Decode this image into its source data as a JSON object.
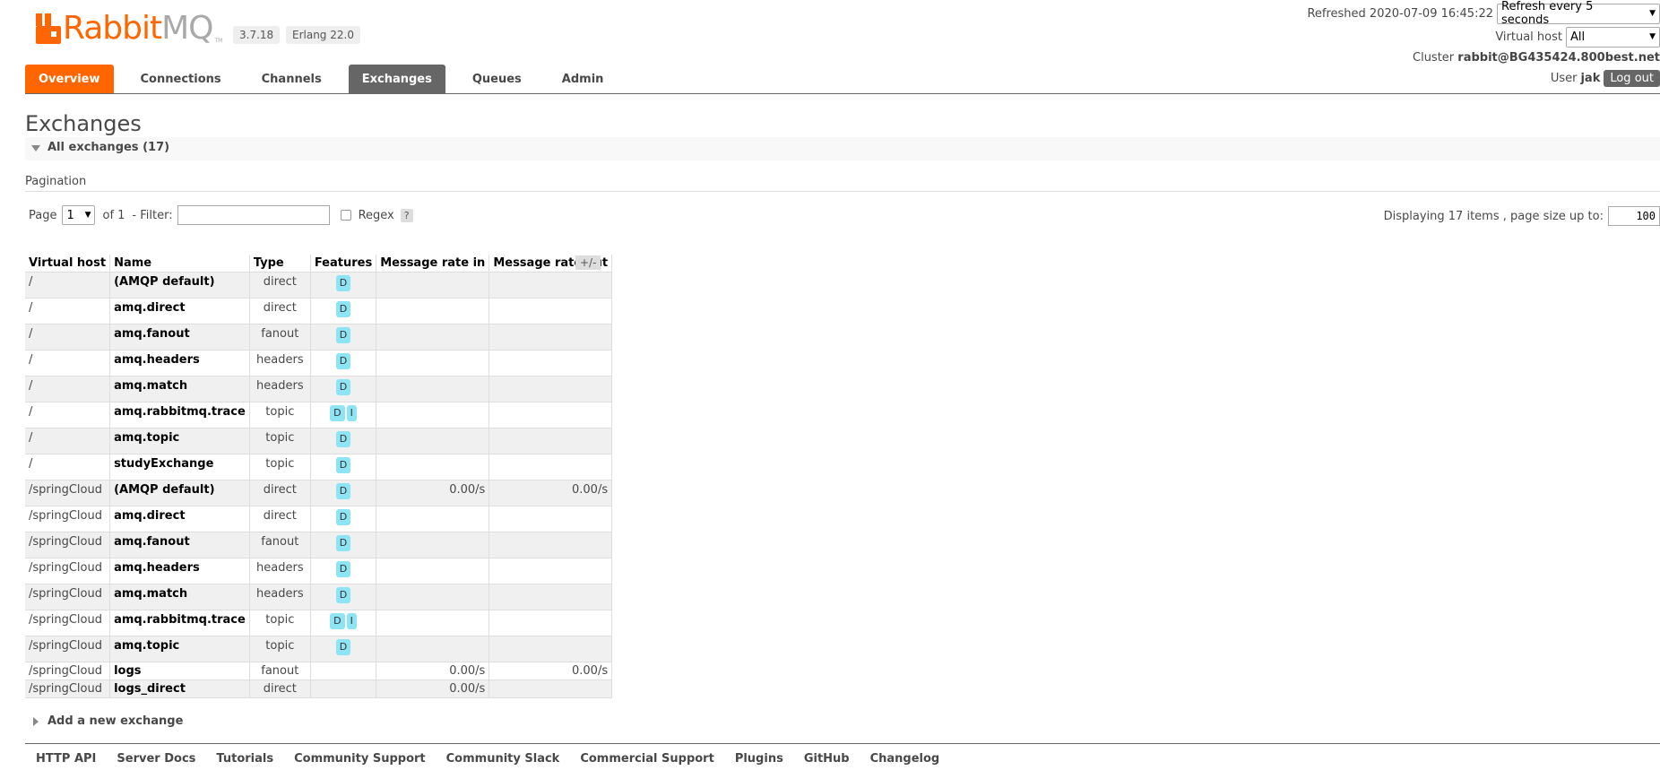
{
  "brand": {
    "word1": "Rabbit",
    "word2": "MQ",
    "tm": "TM",
    "version": "3.7.18",
    "erlang": "Erlang 22.0",
    "brand_color": "#ff6600"
  },
  "header": {
    "refreshed_label": "Refreshed 2020-07-09 16:45:22",
    "refresh_option": "Refresh every 5 seconds",
    "vhost_label": "Virtual host",
    "vhost_value": "All",
    "cluster_label": "Cluster",
    "cluster_value": "rabbit@BG435424.800best.net",
    "user_label": "User",
    "user_value": "jak",
    "logout": "Log out"
  },
  "tabs": [
    {
      "label": "Overview"
    },
    {
      "label": "Connections"
    },
    {
      "label": "Channels"
    },
    {
      "label": "Exchanges"
    },
    {
      "label": "Queues"
    },
    {
      "label": "Admin"
    }
  ],
  "page": {
    "title": "Exchanges",
    "section": "All exchanges (17)",
    "pagination_label": "Pagination",
    "page_label": "Page",
    "page_value": "1",
    "of_label": "of 1",
    "filter_label": "- Filter:",
    "filter_value": "",
    "regex_label": "Regex",
    "help": "?",
    "displaying": "Displaying 17 items , page size up to:",
    "page_size": "100",
    "plusminus": "+/-",
    "add_exchange": "Add a new exchange"
  },
  "table": {
    "headers": [
      "Virtual host",
      "Name",
      "Type",
      "Features",
      "Message rate in",
      "Message rate out"
    ],
    "rows": [
      {
        "vhost": "/",
        "name": "(AMQP default)",
        "type": "direct",
        "f1": "D",
        "f2": "",
        "rin": "",
        "rout": ""
      },
      {
        "vhost": "/",
        "name": "amq.direct",
        "type": "direct",
        "f1": "D",
        "f2": "",
        "rin": "",
        "rout": ""
      },
      {
        "vhost": "/",
        "name": "amq.fanout",
        "type": "fanout",
        "f1": "D",
        "f2": "",
        "rin": "",
        "rout": ""
      },
      {
        "vhost": "/",
        "name": "amq.headers",
        "type": "headers",
        "f1": "D",
        "f2": "",
        "rin": "",
        "rout": ""
      },
      {
        "vhost": "/",
        "name": "amq.match",
        "type": "headers",
        "f1": "D",
        "f2": "",
        "rin": "",
        "rout": ""
      },
      {
        "vhost": "/",
        "name": "amq.rabbitmq.trace",
        "type": "topic",
        "f1": "D",
        "f2": "I",
        "rin": "",
        "rout": ""
      },
      {
        "vhost": "/",
        "name": "amq.topic",
        "type": "topic",
        "f1": "D",
        "f2": "",
        "rin": "",
        "rout": ""
      },
      {
        "vhost": "/",
        "name": "studyExchange",
        "type": "topic",
        "f1": "D",
        "f2": "",
        "rin": "",
        "rout": ""
      },
      {
        "vhost": "/springCloud",
        "name": "(AMQP default)",
        "type": "direct",
        "f1": "D",
        "f2": "",
        "rin": "0.00/s",
        "rout": "0.00/s"
      },
      {
        "vhost": "/springCloud",
        "name": "amq.direct",
        "type": "direct",
        "f1": "D",
        "f2": "",
        "rin": "",
        "rout": ""
      },
      {
        "vhost": "/springCloud",
        "name": "amq.fanout",
        "type": "fanout",
        "f1": "D",
        "f2": "",
        "rin": "",
        "rout": ""
      },
      {
        "vhost": "/springCloud",
        "name": "amq.headers",
        "type": "headers",
        "f1": "D",
        "f2": "",
        "rin": "",
        "rout": ""
      },
      {
        "vhost": "/springCloud",
        "name": "amq.match",
        "type": "headers",
        "f1": "D",
        "f2": "",
        "rin": "",
        "rout": ""
      },
      {
        "vhost": "/springCloud",
        "name": "amq.rabbitmq.trace",
        "type": "topic",
        "f1": "D",
        "f2": "I",
        "rin": "",
        "rout": ""
      },
      {
        "vhost": "/springCloud",
        "name": "amq.topic",
        "type": "topic",
        "f1": "D",
        "f2": "",
        "rin": "",
        "rout": ""
      },
      {
        "vhost": "/springCloud",
        "name": "logs",
        "type": "fanout",
        "f1": "",
        "f2": "",
        "rin": "0.00/s",
        "rout": "0.00/s"
      },
      {
        "vhost": "/springCloud",
        "name": "logs_direct",
        "type": "direct",
        "f1": "",
        "f2": "",
        "rin": "0.00/s",
        "rout": ""
      }
    ]
  },
  "footer": [
    "HTTP API",
    "Server Docs",
    "Tutorials",
    "Community Support",
    "Community Slack",
    "Commercial Support",
    "Plugins",
    "GitHub",
    "Changelog"
  ]
}
